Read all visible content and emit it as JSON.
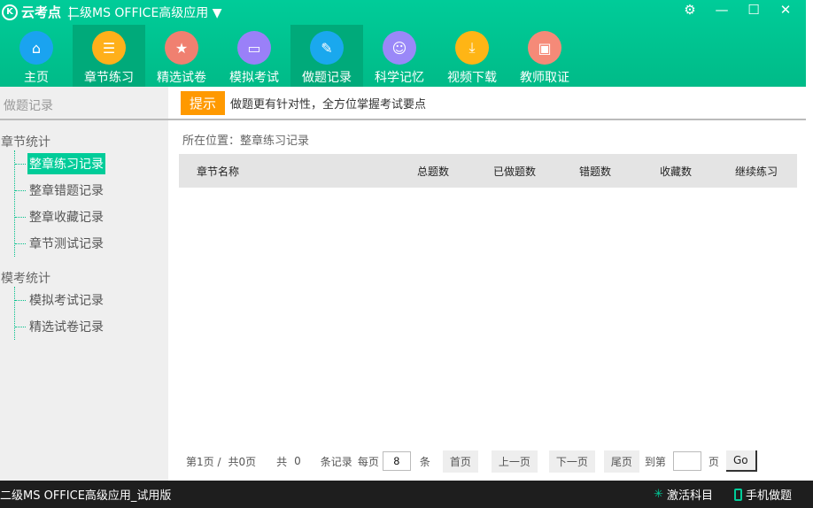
{
  "app": {
    "logo": "云考点",
    "title": "二级MS  OFFICE高级应用"
  },
  "nav": [
    {
      "label": "主页",
      "icon": "home-icon",
      "color": "#1aa3f0",
      "glyph": "⌂"
    },
    {
      "label": "章节练习",
      "icon": "list-icon",
      "color": "#ffb01a",
      "glyph": "☰",
      "active": true
    },
    {
      "label": "精选试卷",
      "icon": "medal-icon",
      "color": "#f08070",
      "glyph": "★"
    },
    {
      "label": "模拟考试",
      "icon": "monitor-icon",
      "color": "#9a80f8",
      "glyph": "▭"
    },
    {
      "label": "做题记录",
      "icon": "pencil-icon",
      "color": "#1aa8ee",
      "glyph": "✎",
      "active": true
    },
    {
      "label": "科学记忆",
      "icon": "brain-icon",
      "color": "#9a88f8",
      "glyph": "☺"
    },
    {
      "label": "视频下载",
      "icon": "download-icon",
      "color": "#ffb515",
      "glyph": "⤓"
    },
    {
      "label": "教师取证",
      "icon": "certificate-icon",
      "color": "#f58a78",
      "glyph": "▣"
    }
  ],
  "sidebar": {
    "header": "做题记录",
    "groups": [
      {
        "label": "章节统计",
        "items": [
          "整章练习记录",
          "整章错题记录",
          "整章收藏记录",
          "章节测试记录"
        ]
      },
      {
        "label": "模考统计",
        "items": [
          "模拟考试记录",
          "精选试卷记录"
        ]
      }
    ]
  },
  "tip": {
    "badge": "提示",
    "text": "做题更有针对性，全方位掌握考试要点"
  },
  "location": "所在位置：整章练习记录",
  "table": {
    "columns": [
      "章节名称",
      "总题数",
      "已做题数",
      "错题数",
      "收藏数",
      "继续练习"
    ]
  },
  "pager": {
    "page": "第1页 /",
    "total_pages": "共0页",
    "total_prefix": "共",
    "total": "0",
    "records": "条记录",
    "per_page": "每页",
    "per_page_value": "8",
    "unit": "条",
    "first": "首页",
    "prev": "上一页",
    "next": "下一页",
    "last": "尾页",
    "goto": "到第",
    "goto_unit": "页",
    "go": "Go"
  },
  "status": {
    "left": "二级MS  OFFICE高级应用_试用版",
    "activate": "激活科目",
    "mobile": "手机做题"
  }
}
